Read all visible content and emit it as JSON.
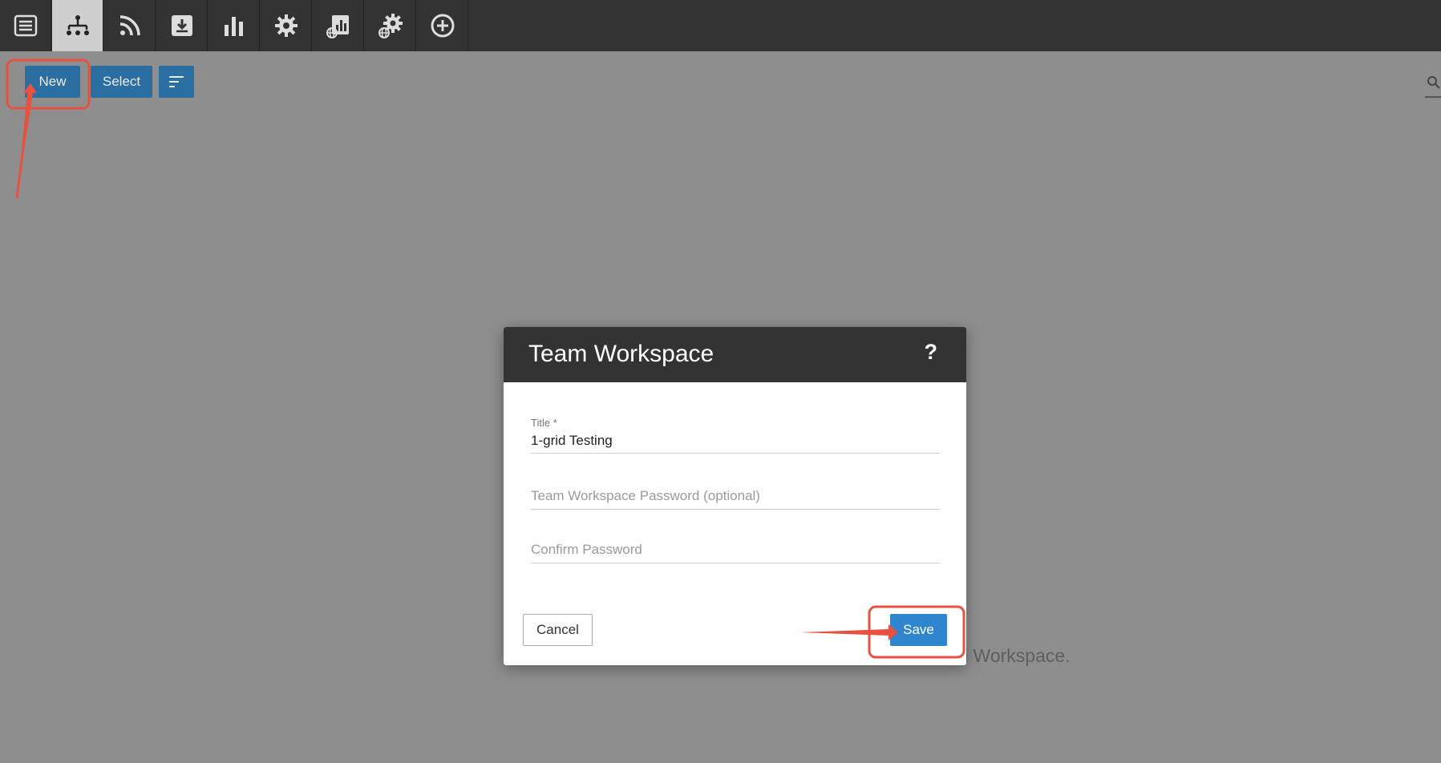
{
  "toolbar": {
    "items": [
      {
        "name": "list-icon"
      },
      {
        "name": "hierarchy-icon",
        "active": true
      },
      {
        "name": "rss-icon"
      },
      {
        "name": "download-icon"
      },
      {
        "name": "bar-chart-icon"
      },
      {
        "name": "gear-icon"
      },
      {
        "name": "web-report-icon"
      },
      {
        "name": "web-settings-icon"
      },
      {
        "name": "add-circle-icon"
      }
    ]
  },
  "actions": {
    "new_label": "New",
    "select_label": "Select",
    "sort_icon": "sort-icon",
    "search_icon": "search-icon"
  },
  "background": {
    "text_fragment": "m Workspace."
  },
  "dialog": {
    "title": "Team Workspace",
    "help": "?",
    "title_label": "Title *",
    "title_value": "1-grid Testing",
    "password_placeholder": "Team Workspace Password (optional)",
    "confirm_placeholder": "Confirm Password",
    "cancel_label": "Cancel",
    "save_label": "Save"
  },
  "colors": {
    "toolbar_bg": "#333333",
    "action_button": "#2b6ea1",
    "save_button": "#2f86cf",
    "annotation": "#e8503f"
  }
}
